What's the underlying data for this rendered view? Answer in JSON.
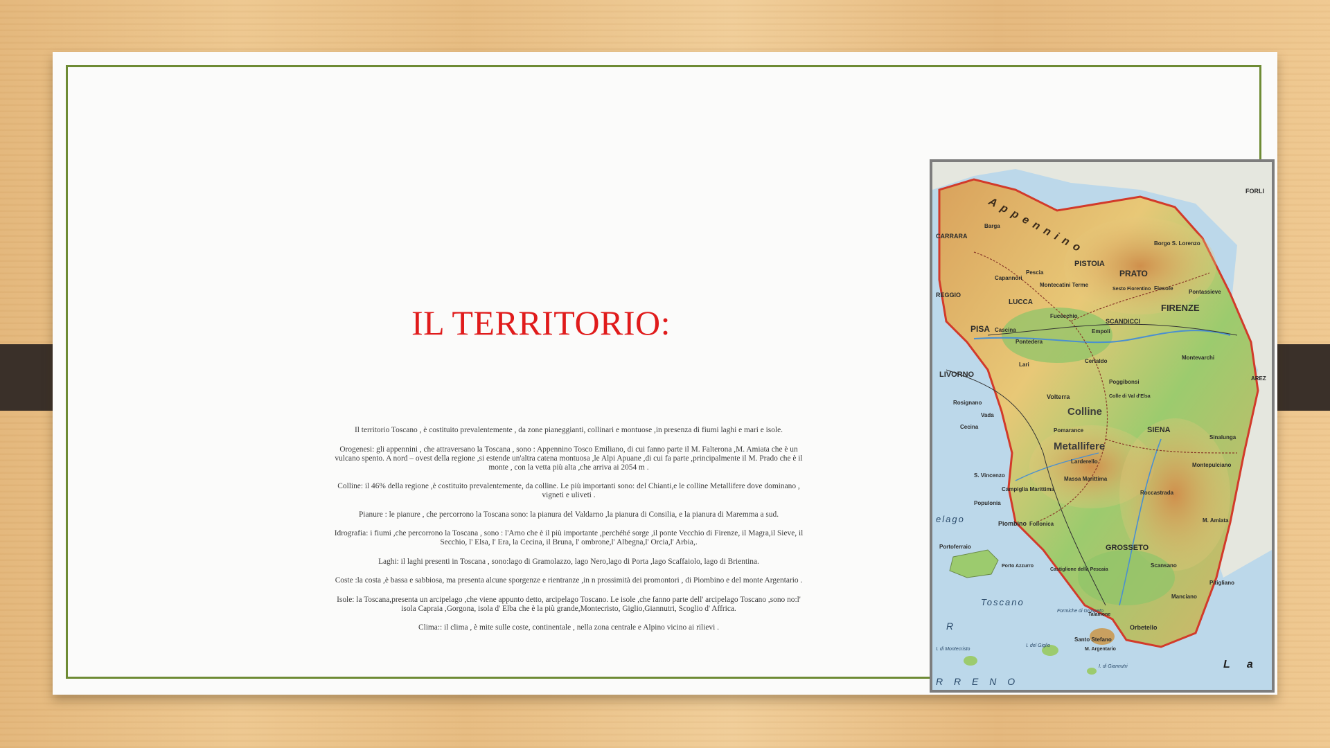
{
  "slide": {
    "title": "IL TERRITORIO:",
    "paragraphs": [
      "Il territorio Toscano , è costituito prevalentemente , da zone pianeggianti, collinari e montuose ,in presenza di fiumi laghi e mari e isole.",
      "Orogenesi: gli appennini , che attraversano la Toscana , sono : Appennino Tosco Emiliano, di cui fanno parte il M. Falterona ,M. Amiata che è un vulcano spento. A nord – ovest della regione ,si estende un'altra catena montuosa ,le Alpi Apuane ,di cui fa parte ,principalmente il M. Prado che è il monte , con la vetta più alta ,che arriva ai 2054 m .",
      "Colline: il 46% della regione ,è costituito prevalentemente, da colline. Le più importanti sono: del Chianti,e le colline Metallifere dove dominano , vigneti e uliveti .",
      "Pianure : le pianure , che percorrono la Toscana sono: la pianura del Valdarno ,la pianura di Consilia, e la pianura di Maremma a sud.",
      "Idrografia: i fiumi ,che percorrono la Toscana , sono : l'Arno che è il più importante ,perchéhé sorge ,il ponte Vecchio di Firenze, il Magra,il Sieve, il Secchio, l' Elsa, l' Era, la Cecina, il Bruna, l' ombrone,l' Albegna,l' Orcia,l' Arbia,.",
      "Laghi: il laghi presenti in Toscana , sono:lago di Gramolazzo, lago Nero,lago di Porta ,lago Scaffaiolo, lago di Brientina.",
      "Coste :la costa ,è bassa e sabbiosa, ma presenta alcune sporgenze e rientranze ,in n prossimità dei promontori , di Piombino e del monte Argentario .",
      "Isole: la Toscana,presenta un arcipelago ,che viene appunto detto, arcipelago Toscano. Le isole ,che fanno parte dell' arcipelago Toscano ,sono no:l' isola Capraia ,Gorgona, isola d' Elba che è la più grande,Montecristo, Giglio,Giannutri, Scoglio d' Affrica.",
      "Clima:: il clima , è mite sulle coste, continentale , nella zona centrale e Alpino vicino ai rilievi ."
    ]
  },
  "map": {
    "cities": [
      "PISTOIA",
      "PRATO",
      "FIRENZE",
      "LUCCA",
      "PISA",
      "LIVORNO",
      "SIENA",
      "GROSSETO",
      "SCANDICCI",
      "Volterra",
      "Colline",
      "Metallifere",
      "Piombino",
      "Orbetello",
      "Follonica",
      "Massa Marittima",
      "Montepulciano",
      "Empoli",
      "CARRARA",
      "REGGIO",
      "Portoferraio",
      "Santo Stefano",
      "Talamone",
      "Rosignano",
      "Cecina",
      "Poggibonsi",
      "Certaldo",
      "Montecatini Terme",
      "Montevarchi",
      "Sinalunga",
      "Roccastrada",
      "Scansano",
      "Pitigliano",
      "Manciano",
      "Capannori",
      "Pescia",
      "Fucecchio",
      "Pontedera",
      "Cascina",
      "Colle di Val d'Elsa",
      "Pomarance",
      "Sesto Fiorentino",
      "Fiesole",
      "Pontassieve",
      "Borgo S. Lorenzo",
      "Campiglia Marittima",
      "Castiglione della Pescaia",
      "M. Amiata",
      "M. Argentario",
      "Porto Azzurro",
      "Populonia",
      "S. Vincenzo",
      "Vada",
      "Larderello",
      "Lari",
      "Barga",
      "FORLI",
      "AREZ"
    ],
    "sea_labels": [
      "Toscano",
      "R R E N O",
      "L a",
      "elago",
      "R"
    ],
    "island_labels": [
      "I. di Montecristo",
      "I. del Giglio",
      "I. di Giannutri",
      "Formiche di Grosseto"
    ],
    "range_label": "Appennino",
    "colors": {
      "sea": "#bcd8ea",
      "lowland": "#8fc46a",
      "hills": "#e9d27a",
      "mountains": "#d9a25c",
      "border": "#d23a2a",
      "city": "#2b2b2b"
    }
  }
}
